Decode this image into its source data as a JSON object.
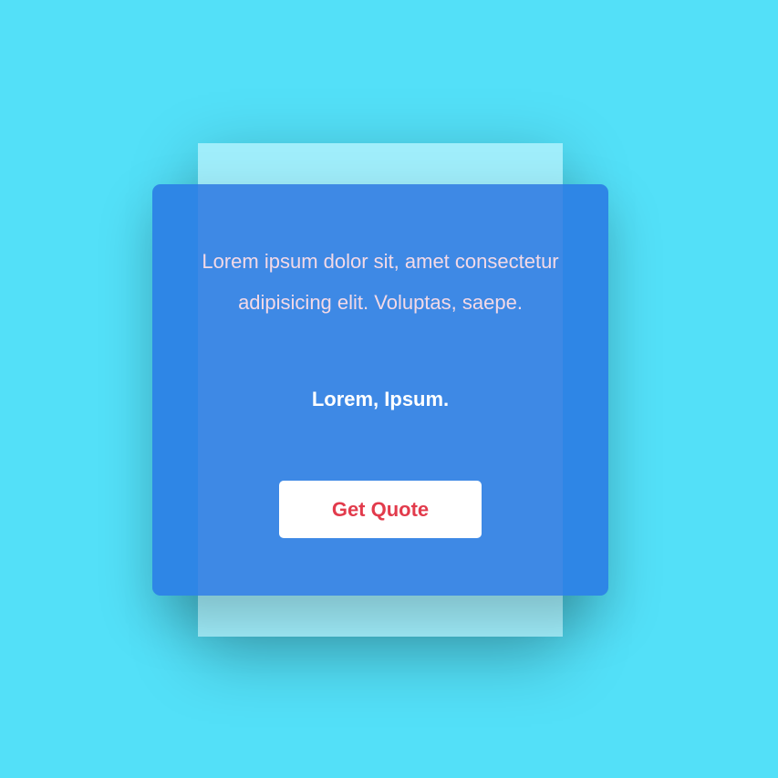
{
  "card": {
    "message": "Lorem ipsum dolor sit, amet consectetur adipisicing elit. Voluptas, saepe.",
    "author": "Lorem, Ipsum.",
    "button_label": "Get Quote"
  },
  "colors": {
    "background": "#53e0f8",
    "card": "#2e86e6",
    "card_center": "#3e89e5",
    "message_text": "#f3d9e6",
    "button_text": "#e23b4c",
    "button_background": "#ffffff"
  }
}
